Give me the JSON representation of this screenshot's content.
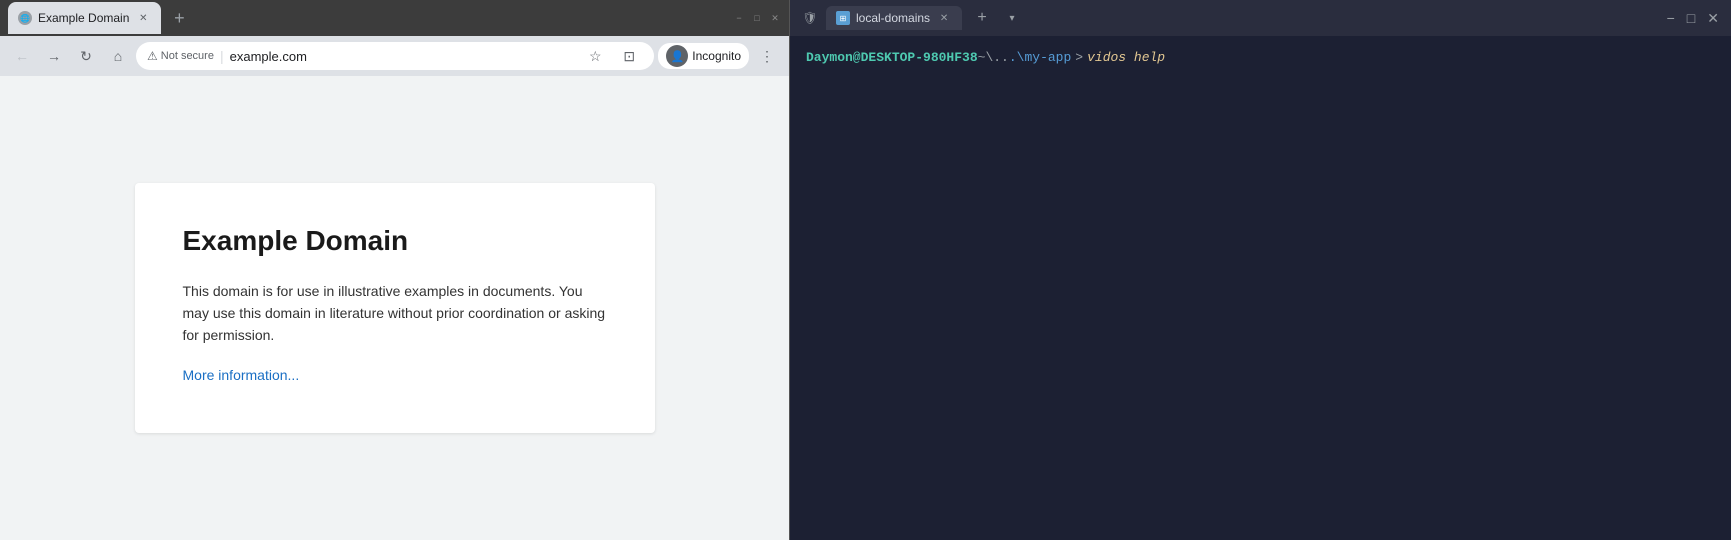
{
  "browser": {
    "title_bar": {
      "tab_label": "Example Domain",
      "tab_icon": "globe",
      "new_tab_label": "+",
      "minimize_label": "−",
      "maximize_label": "□",
      "close_label": "✕"
    },
    "nav_bar": {
      "back_label": "←",
      "forward_label": "→",
      "reload_label": "↻",
      "home_label": "⌂",
      "not_secure_label": "Not secure",
      "address": "example.com",
      "bookmark_label": "☆",
      "extensions_label": "⊡",
      "incognito_label": "Incognito",
      "menu_label": "⋮"
    },
    "page": {
      "title": "Example Domain",
      "body": "This domain is for use in illustrative examples in documents. You may use this domain in literature without prior coordination or asking for permission.",
      "link": "More information..."
    }
  },
  "terminal": {
    "title_bar": {
      "tab_label": "local-domains",
      "new_tab_label": "+",
      "dropdown_label": "▾",
      "close_label": "✕",
      "minimize_label": "−",
      "maximize_label": "□",
      "win_close_label": "✕"
    },
    "prompt": {
      "user": "Daymon@DESKTOP-980HF38",
      "separator1": " ~\\.",
      "separator2": ".",
      "path": " .\\my-app",
      "arrow": ">",
      "command": "vidos help"
    }
  }
}
